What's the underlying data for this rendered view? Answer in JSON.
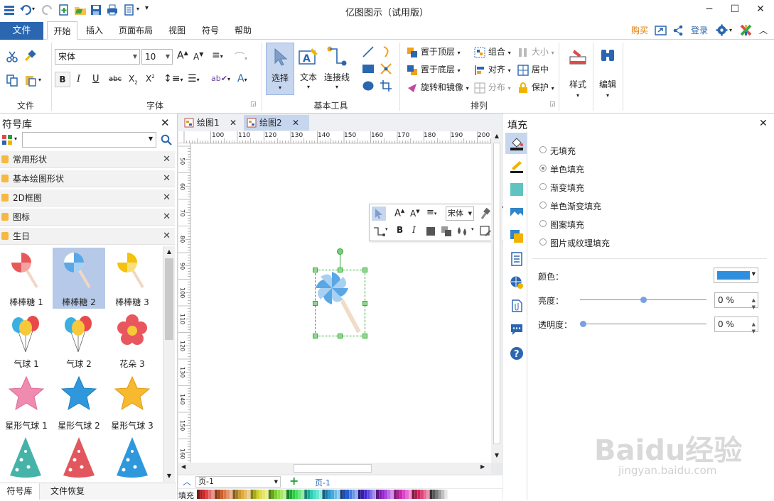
{
  "app": {
    "title": "亿图图示（试用版）"
  },
  "menu": {
    "file": "文件",
    "tabs": [
      "开始",
      "插入",
      "页面布局",
      "视图",
      "符号",
      "帮助"
    ],
    "buy": "购买",
    "login": "登录"
  },
  "ribbon": {
    "groups": {
      "file": "文件",
      "font": "字体",
      "basic_tools": "基本工具",
      "arrange": "排列"
    },
    "font_name": "宋体",
    "font_size": "10",
    "select": "选择",
    "text": "文本",
    "connector": "连接线",
    "bring_to_front": "置于顶层",
    "send_to_back": "置于底层",
    "rotate_mirror": "旋转和镜像",
    "group": "组合",
    "align": "对齐",
    "distribute": "分布",
    "size": "大小",
    "center": "居中",
    "protect": "保护",
    "style": "样式",
    "edit": "编辑"
  },
  "library": {
    "title": "符号库",
    "search_placeholder": "",
    "categories": [
      "常用形状",
      "基本绘图形状",
      "2D框图",
      "图标",
      "生日"
    ],
    "symbols": [
      "棒棒糖 1",
      "棒棒糖 2",
      "棒棒糖 3",
      "气球 1",
      "气球 2",
      "花朵 3",
      "星形气球 1",
      "星形气球 2",
      "星形气球 3"
    ],
    "bottom_tabs": [
      "符号库",
      "文件恢复"
    ]
  },
  "documents": {
    "tabs": [
      "绘图1",
      "绘图2"
    ],
    "active": "绘图2"
  },
  "ruler": {
    "h": [
      "100",
      "110",
      "120",
      "130",
      "140",
      "150",
      "160",
      "170",
      "180",
      "190",
      "200"
    ],
    "v": [
      "50",
      "60",
      "70",
      "80",
      "90",
      "100",
      "110",
      "120",
      "130",
      "140",
      "150",
      "160"
    ]
  },
  "mini_toolbar": {
    "font": "宋体"
  },
  "pages": {
    "current": "页-1",
    "tab": "页-1"
  },
  "fill_bar": {
    "label": "填充"
  },
  "fill_panel": {
    "title": "填充",
    "options": [
      "无填充",
      "单色填充",
      "渐变填充",
      "单色渐变填充",
      "图案填充",
      "图片或纹理填充"
    ],
    "selected": "单色填充",
    "color_label": "颜色：",
    "color_value": "#2f8fdf",
    "brightness_label": "亮度：",
    "brightness_value": "0 %",
    "brightness_level": 0.5,
    "transparency_label": "透明度：",
    "transparency_value": "0 %",
    "transparency_level": 0
  },
  "watermark": {
    "text": "Baidu经验",
    "sub": "jingyan.baidu.com"
  },
  "colors": {
    "accent": "#2b66b0",
    "orange": "#e07b00",
    "selected": "#b7c9e8"
  }
}
